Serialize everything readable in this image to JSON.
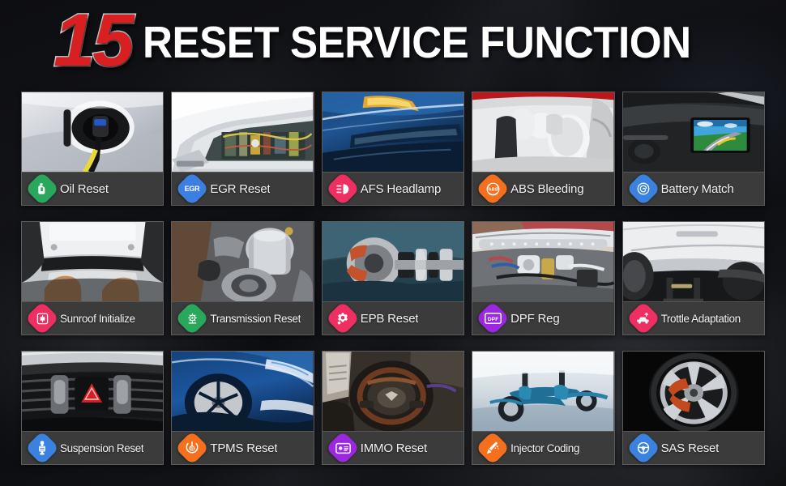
{
  "header": {
    "number": "15",
    "title": "RESET SERVICE FUNCTION"
  },
  "colors": {
    "background": "#0b0c0f",
    "card_bar": "#3b3b3b",
    "title_number": "#d81f22",
    "title_text": "#ffffff",
    "green": "#29a85c",
    "blue": "#3b82e0",
    "pink": "#ef2f62",
    "orange": "#f4701e",
    "purple": "#9b27e0",
    "light_blue": "#4a9bea"
  },
  "grid": {
    "rows": [
      [
        {
          "label": "Oil Reset",
          "icon": "oil-can-icon",
          "icon_color": "#29a85c",
          "badge_text": ""
        },
        {
          "label": "EGR Reset",
          "icon": "egr-icon",
          "icon_color": "#3b7fe0",
          "badge_text": "EGR"
        },
        {
          "label": "AFS Headlamp",
          "icon": "headlamp-icon",
          "icon_color": "#ef2f62",
          "badge_text": ""
        },
        {
          "label": "ABS Bleeding",
          "icon": "abs-brake-icon",
          "icon_color": "#f4701e",
          "badge_text": ""
        },
        {
          "label": "Battery Match",
          "icon": "battery-spiral-icon",
          "icon_color": "#3b82e0",
          "badge_text": ""
        }
      ],
      [
        {
          "label": "Sunroof Initialize",
          "icon": "sunroof-icon",
          "icon_color": "#ef2f62",
          "badge_text": ""
        },
        {
          "label": "Transmission Reset",
          "icon": "transmission-gear-icon",
          "icon_color": "#29a85c",
          "badge_text": ""
        },
        {
          "label": "EPB Reset",
          "icon": "epb-gear-icon",
          "icon_color": "#ef2f62",
          "badge_text": ""
        },
        {
          "label": "DPF Reg",
          "icon": "dpf-icon",
          "icon_color": "#9b27e0",
          "badge_text": "DPF"
        },
        {
          "label": "Trottle Adaptation",
          "icon": "throttle-car-icon",
          "icon_color": "#ef2f62",
          "badge_text": ""
        }
      ],
      [
        {
          "label": "Suspension Reset",
          "icon": "suspension-shock-icon",
          "icon_color": "#3b82e0",
          "badge_text": ""
        },
        {
          "label": "TPMS Reset",
          "icon": "tpms-tire-icon",
          "icon_color": "#f4701e",
          "badge_text": ""
        },
        {
          "label": "IMMO Reset",
          "icon": "immo-key-icon",
          "icon_color": "#9b27e0",
          "badge_text": ""
        },
        {
          "label": "Injector Coding",
          "icon": "injector-icon",
          "icon_color": "#f4701e",
          "badge_text": ""
        },
        {
          "label": "SAS Reset",
          "icon": "steering-angle-icon",
          "icon_color": "#3b82e0",
          "badge_text": ""
        }
      ]
    ]
  },
  "thumbnails": [
    "ev-charging-port-photo",
    "engine-bay-open-hood-photo",
    "blue-car-headlight-photo",
    "deployed-airbags-photo",
    "dashboard-navigation-screen-photo",
    "car-sunroof-interior-photo",
    "transmission-internals-photo",
    "brake-driveshaft-assembly-photo",
    "engine-intake-dpf-photo",
    "white-car-underbody-photo",
    "dashboard-hazard-button-photo",
    "blue-car-front-wheel-photo",
    "steering-wheel-interior-photo",
    "car-chassis-suspension-photo",
    "alloy-wheel-rim-photo"
  ]
}
